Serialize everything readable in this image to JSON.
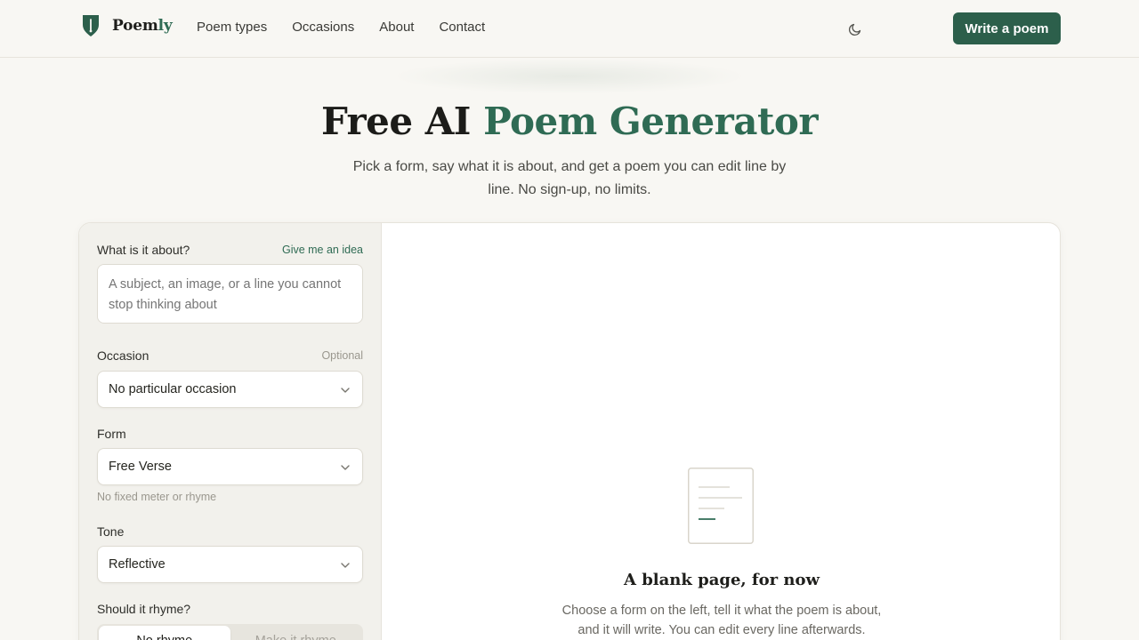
{
  "header": {
    "logo_text_main": "Poem",
    "logo_text_accent": "ly",
    "nav": [
      {
        "label": "Poem types"
      },
      {
        "label": "Occasions"
      },
      {
        "label": "About"
      },
      {
        "label": "Contact"
      }
    ],
    "theme_toggle_icon": "moon-icon",
    "cta_label": "Write a poem"
  },
  "hero": {
    "title_plain": "Free AI",
    "title_accent": "Poem Generator",
    "subtitle": "Pick a form, say what it is about, and get a poem you can edit line by line. No sign-up, no limits."
  },
  "form": {
    "subject": {
      "label": "What is it about?",
      "idea_link": "Give me an idea",
      "placeholder": "A subject, an image, or a line you cannot stop thinking about",
      "value": ""
    },
    "occasion": {
      "label": "Occasion",
      "aux": "Optional",
      "value": "No particular occasion"
    },
    "form_type": {
      "label": "Form",
      "value": "Free Verse",
      "hint": "No fixed meter or rhyme"
    },
    "tone": {
      "label": "Tone",
      "value": "Reflective"
    },
    "rhyme": {
      "label": "Should it rhyme?",
      "options": [
        {
          "label": "No rhyme",
          "selected": true
        },
        {
          "label": "Make it rhyme",
          "selected": false
        }
      ]
    }
  },
  "output": {
    "empty_icon": "document-icon",
    "empty_title": "A blank page, for now",
    "empty_text": "Choose a form on the left, tell it what the poem is about, and it will write. You can edit every line afterwards."
  },
  "colors": {
    "accent": "#2c5f4b",
    "background": "#f8f7f3",
    "sidebar": "#f2f1ec"
  }
}
